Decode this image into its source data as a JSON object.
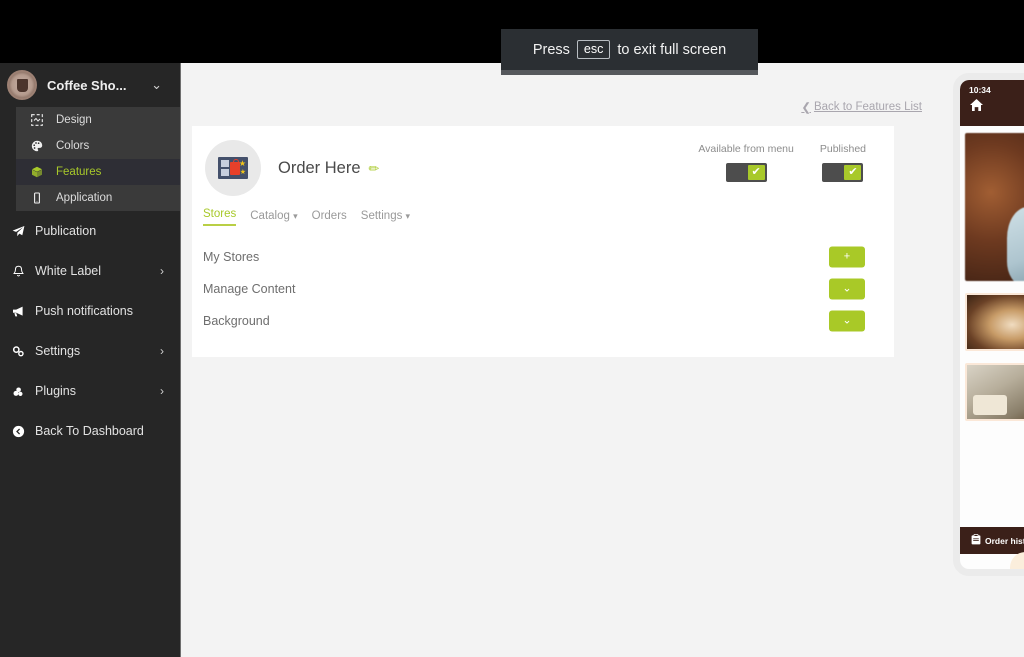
{
  "fullscreen_banner": {
    "prefix": "Press",
    "key": "esc",
    "suffix": "to exit full screen"
  },
  "sidebar": {
    "brand": {
      "name": "Coffee Sho...",
      "chevron": "⌄",
      "logo_icon": "coffee-cup-logo"
    },
    "submenu": [
      {
        "label": "Design",
        "icon": "design-icon",
        "active": false
      },
      {
        "label": "Colors",
        "icon": "palette-icon",
        "active": false
      },
      {
        "label": "Features",
        "icon": "cube-icon",
        "active": true
      },
      {
        "label": "Application",
        "icon": "mobile-icon",
        "active": false
      }
    ],
    "nav": [
      {
        "label": "Publication",
        "icon": "paper-plane-icon",
        "arrow": ""
      },
      {
        "label": "White Label",
        "icon": "bell-icon",
        "arrow": "›"
      },
      {
        "label": "Push notifications",
        "icon": "megaphone-icon",
        "arrow": ""
      },
      {
        "label": "Settings",
        "icon": "cogs-icon",
        "arrow": "›"
      },
      {
        "label": "Plugins",
        "icon": "plugins-icon",
        "arrow": "›"
      },
      {
        "label": "Back To Dashboard",
        "icon": "back-circle-icon",
        "arrow": ""
      }
    ]
  },
  "main": {
    "back_link": {
      "caret": "❮",
      "label": "Back to Features List"
    },
    "feature": {
      "icon_name": "order-here-feature-icon",
      "title": "Order Here",
      "edit_icon": "✏"
    },
    "toggles": [
      {
        "label": "Available from menu",
        "state": "on",
        "mark": "✔"
      },
      {
        "label": "Published",
        "state": "on",
        "mark": "✔"
      }
    ],
    "tabs": [
      {
        "label": "Stores",
        "caret": "",
        "active": true
      },
      {
        "label": "Catalog",
        "caret": "▾",
        "active": false
      },
      {
        "label": "Orders",
        "caret": "",
        "active": false
      },
      {
        "label": "Settings",
        "caret": "▾",
        "active": false
      }
    ],
    "rows": [
      {
        "label": "My Stores",
        "button": "+",
        "button_icon": "plus-icon"
      },
      {
        "label": "Manage Content",
        "button": "⌄",
        "button_icon": "chevron-down-icon"
      },
      {
        "label": "Background",
        "button": "⌄",
        "button_icon": "chevron-down-icon"
      }
    ]
  },
  "preview": {
    "status_time": "10:34",
    "home_icon": "🏠",
    "footer": {
      "icon": "📋",
      "label": "Order history"
    }
  },
  "colors": {
    "accent_green": "#a8c92a",
    "sidebar_bg": "#262626",
    "brand_brown": "#3b2019",
    "page_bg": "#f3f3f3"
  }
}
